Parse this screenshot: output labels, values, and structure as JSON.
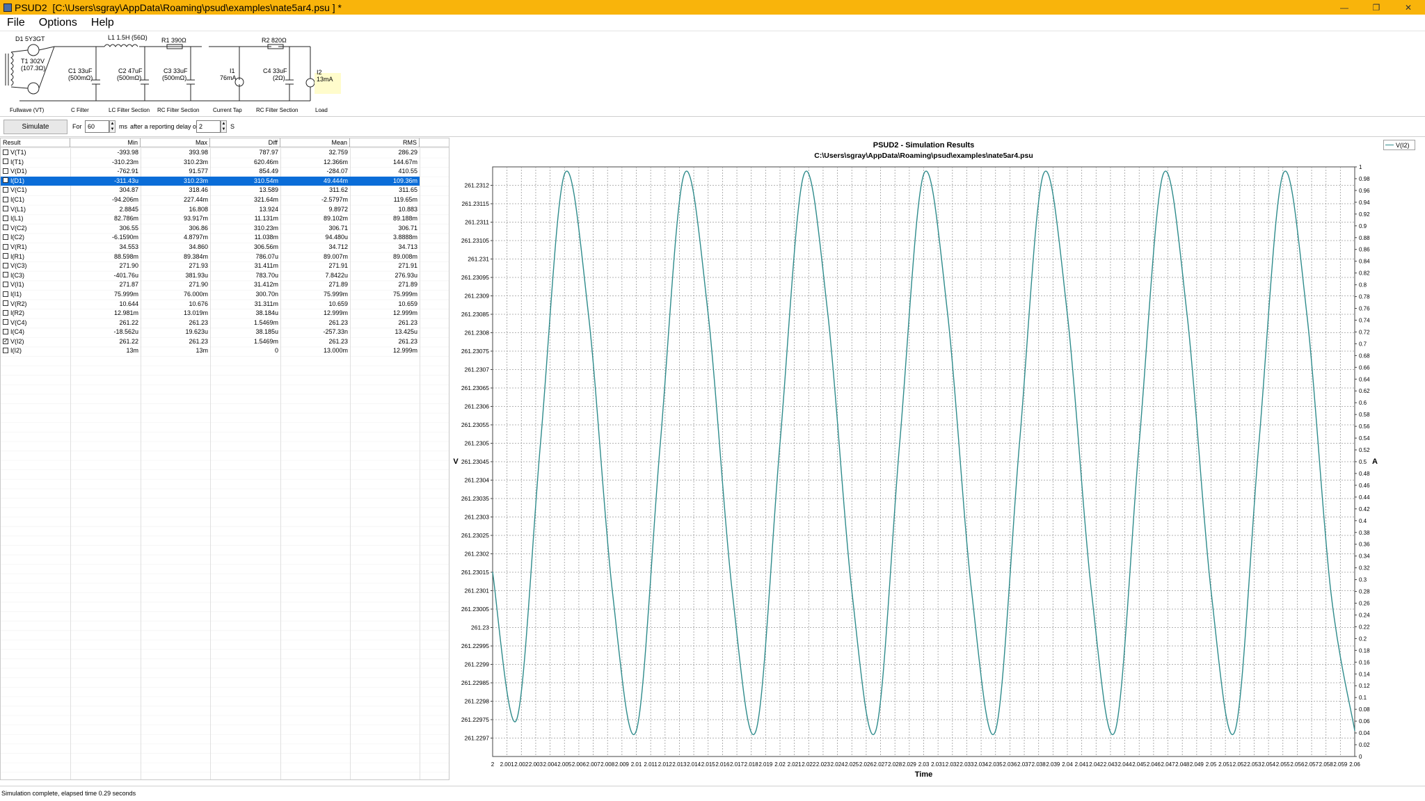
{
  "window": {
    "title": "PSUD2  [C:\\Users\\sgray\\AppData\\Roaming\\psud\\examples\\nate5ar4.psu ] *"
  },
  "menu": {
    "items": [
      "File",
      "Options",
      "Help"
    ]
  },
  "schematic": {
    "components": {
      "d1": "D1 5Y3GT",
      "t1_a": "T1 302V",
      "t1_b": "(107.3Ω)",
      "l1": "L1 1.5H (56Ω)",
      "r1": "R1 390Ω",
      "r2": "R2 820Ω",
      "c1_a": "C1 33uF",
      "c1_b": "(500mΩ)",
      "c2_a": "C2 47uF",
      "c2_b": "(500mΩ)",
      "c3_a": "C3 33uF",
      "c3_b": "(500mΩ)",
      "i1_a": "I1",
      "i1_b": "76mA",
      "c4_a": "C4 33uF",
      "c4_b": "(2Ω)",
      "i2_a": "I2",
      "i2_b": "13mA"
    },
    "section_labels": [
      "Fullwave (VT)",
      "C Filter",
      "LC Filter Section",
      "RC Filter Section",
      "Current Tap",
      "RC Filter Section",
      "Load"
    ]
  },
  "toolbar": {
    "simulate_label": "Simulate",
    "for_label": "For",
    "for_value": "60",
    "ms_label": "ms",
    "delay_label": "after a reporting delay of",
    "delay_value": "2",
    "s_label": "S"
  },
  "results": {
    "headers": [
      "Result",
      "Min",
      "Max",
      "Diff",
      "Mean",
      "RMS"
    ],
    "rows": [
      {
        "name": "V(T1)",
        "min": "-393.98",
        "max": "393.98",
        "diff": "787.97",
        "mean": "32.759",
        "rms": "286.29",
        "checked": false,
        "selected": false
      },
      {
        "name": "I(T1)",
        "min": "-310.23m",
        "max": "310.23m",
        "diff": "620.46m",
        "mean": "12.366m",
        "rms": "144.67m",
        "checked": false,
        "selected": false
      },
      {
        "name": "V(D1)",
        "min": "-762.91",
        "max": "91.577",
        "diff": "854.49",
        "mean": "-284.07",
        "rms": "410.55",
        "checked": false,
        "selected": false
      },
      {
        "name": "I(D1)",
        "min": "-311.43u",
        "max": "310.23m",
        "diff": "310.54m",
        "mean": "49.444m",
        "rms": "109.36m",
        "checked": false,
        "selected": true
      },
      {
        "name": "V(C1)",
        "min": "304.87",
        "max": "318.46",
        "diff": "13.589",
        "mean": "311.62",
        "rms": "311.65",
        "checked": false,
        "selected": false
      },
      {
        "name": "I(C1)",
        "min": "-94.206m",
        "max": "227.44m",
        "diff": "321.64m",
        "mean": "-2.5797m",
        "rms": "119.65m",
        "checked": false,
        "selected": false
      },
      {
        "name": "V(L1)",
        "min": "2.8845",
        "max": "16.808",
        "diff": "13.924",
        "mean": "9.8972",
        "rms": "10.883",
        "checked": false,
        "selected": false
      },
      {
        "name": "I(L1)",
        "min": "82.786m",
        "max": "93.917m",
        "diff": "11.131m",
        "mean": "89.102m",
        "rms": "89.188m",
        "checked": false,
        "selected": false
      },
      {
        "name": "V(C2)",
        "min": "306.55",
        "max": "306.86",
        "diff": "310.23m",
        "mean": "306.71",
        "rms": "306.71",
        "checked": false,
        "selected": false
      },
      {
        "name": "I(C2)",
        "min": "-6.1590m",
        "max": "4.8797m",
        "diff": "11.038m",
        "mean": "94.480u",
        "rms": "3.8888m",
        "checked": false,
        "selected": false
      },
      {
        "name": "V(R1)",
        "min": "34.553",
        "max": "34.860",
        "diff": "306.56m",
        "mean": "34.712",
        "rms": "34.713",
        "checked": false,
        "selected": false
      },
      {
        "name": "I(R1)",
        "min": "88.598m",
        "max": "89.384m",
        "diff": "786.07u",
        "mean": "89.007m",
        "rms": "89.008m",
        "checked": false,
        "selected": false
      },
      {
        "name": "V(C3)",
        "min": "271.90",
        "max": "271.93",
        "diff": "31.411m",
        "mean": "271.91",
        "rms": "271.91",
        "checked": false,
        "selected": false
      },
      {
        "name": "I(C3)",
        "min": "-401.76u",
        "max": "381.93u",
        "diff": "783.70u",
        "mean": "7.8422u",
        "rms": "276.93u",
        "checked": false,
        "selected": false
      },
      {
        "name": "V(I1)",
        "min": "271.87",
        "max": "271.90",
        "diff": "31.412m",
        "mean": "271.89",
        "rms": "271.89",
        "checked": false,
        "selected": false
      },
      {
        "name": "I(I1)",
        "min": "75.999m",
        "max": "76.000m",
        "diff": "300.70n",
        "mean": "75.999m",
        "rms": "75.999m",
        "checked": false,
        "selected": false
      },
      {
        "name": "V(R2)",
        "min": "10.644",
        "max": "10.676",
        "diff": "31.311m",
        "mean": "10.659",
        "rms": "10.659",
        "checked": false,
        "selected": false
      },
      {
        "name": "I(R2)",
        "min": "12.981m",
        "max": "13.019m",
        "diff": "38.184u",
        "mean": "12.999m",
        "rms": "12.999m",
        "checked": false,
        "selected": false
      },
      {
        "name": "V(C4)",
        "min": "261.22",
        "max": "261.23",
        "diff": "1.5469m",
        "mean": "261.23",
        "rms": "261.23",
        "checked": false,
        "selected": false
      },
      {
        "name": "I(C4)",
        "min": "-18.562u",
        "max": "19.623u",
        "diff": "38.185u",
        "mean": "-257.33n",
        "rms": "13.425u",
        "checked": false,
        "selected": false
      },
      {
        "name": "V(I2)",
        "min": "261.22",
        "max": "261.23",
        "diff": "1.5469m",
        "mean": "261.23",
        "rms": "261.23",
        "checked": true,
        "selected": false
      },
      {
        "name": "I(I2)",
        "min": "13m",
        "max": "13m",
        "diff": "0",
        "mean": "13.000m",
        "rms": "12.999m",
        "checked": false,
        "selected": false
      }
    ]
  },
  "chart_data": {
    "type": "line",
    "title": "PSUD2 - Simulation Results",
    "subtitle": "C:\\Users\\sgray\\AppData\\Roaming\\psud\\examples\\nate5ar4.psu",
    "xlabel": "Time",
    "ylabel": "V",
    "y2label": "A",
    "xlim": [
      2.0,
      2.06
    ],
    "ylim": [
      261.22965,
      261.23125
    ],
    "y2lim": [
      0,
      1
    ],
    "x_ticks": [
      "2",
      "2.001",
      "2.002",
      "2.003",
      "2.004",
      "2.005",
      "2.006",
      "2.007",
      "2.008",
      "2.009",
      "2.01",
      "2.011",
      "2.012",
      "2.013",
      "2.014",
      "2.015",
      "2.016",
      "2.017",
      "2.018",
      "2.019",
      "2.02",
      "2.021",
      "2.022",
      "2.023",
      "2.024",
      "2.025",
      "2.026",
      "2.027",
      "2.028",
      "2.029",
      "2.03",
      "2.031",
      "2.032",
      "2.033",
      "2.034",
      "2.035",
      "2.036",
      "2.037",
      "2.038",
      "2.039",
      "2.04",
      "2.041",
      "2.042",
      "2.043",
      "2.044",
      "2.045",
      "2.046",
      "2.047",
      "2.048",
      "2.049",
      "2.05",
      "2.051",
      "2.052",
      "2.053",
      "2.054",
      "2.055",
      "2.056",
      "2.057",
      "2.058",
      "2.059",
      "2.06"
    ],
    "y_ticks": [
      "261.2297",
      "261.22975",
      "261.2298",
      "261.22985",
      "261.2299",
      "261.22995",
      "261.23",
      "261.23005",
      "261.2301",
      "261.23015",
      "261.2302",
      "261.23025",
      "261.2303",
      "261.23035",
      "261.2304",
      "261.23045",
      "261.2305",
      "261.23055",
      "261.2306",
      "261.23065",
      "261.2307",
      "261.23075",
      "261.2308",
      "261.23085",
      "261.2309",
      "261.23095",
      "261.231",
      "261.23105",
      "261.2311",
      "261.23115",
      "261.2312"
    ],
    "y2_ticks": [
      "0",
      "0.02",
      "0.04",
      "0.06",
      "0.08",
      "0.1",
      "0.12",
      "0.14",
      "0.16",
      "0.18",
      "0.2",
      "0.22",
      "0.24",
      "0.26",
      "0.28",
      "0.3",
      "0.32",
      "0.34",
      "0.36",
      "0.38",
      "0.4",
      "0.42",
      "0.44",
      "0.46",
      "0.48",
      "0.5",
      "0.52",
      "0.54",
      "0.56",
      "0.58",
      "0.6",
      "0.62",
      "0.64",
      "0.66",
      "0.68",
      "0.7",
      "0.72",
      "0.74",
      "0.76",
      "0.78",
      "0.8",
      "0.82",
      "0.84",
      "0.86",
      "0.88",
      "0.9",
      "0.92",
      "0.94",
      "0.96",
      "0.98",
      "1"
    ],
    "grid": true,
    "legend": "top-right",
    "series": [
      {
        "name": "V(I2)",
        "color": "#2e8b8b",
        "x": [
          2.0,
          2.00167,
          2.00333,
          2.005,
          2.00667,
          2.00833,
          2.01,
          2.01167,
          2.01333,
          2.015,
          2.01667,
          2.01833,
          2.02,
          2.02167,
          2.02333,
          2.025,
          2.02667,
          2.02833,
          2.03,
          2.03167,
          2.03333,
          2.035,
          2.03667,
          2.03833,
          2.04,
          2.04167,
          2.04333,
          2.045,
          2.04667,
          2.04833,
          2.05,
          2.05167,
          2.05333,
          2.055,
          2.05667,
          2.05833,
          2.06
        ],
        "y": [
          261.23015,
          261.22975,
          261.2305,
          261.23123,
          261.23085,
          261.2301,
          261.22972,
          261.2305,
          261.23123,
          261.23085,
          261.2301,
          261.22972,
          261.2305,
          261.23123,
          261.23085,
          261.2301,
          261.22972,
          261.2305,
          261.23123,
          261.23085,
          261.2301,
          261.22972,
          261.2305,
          261.23123,
          261.23085,
          261.2301,
          261.22972,
          261.2305,
          261.23123,
          261.23085,
          261.2301,
          261.22972,
          261.2305,
          261.23123,
          261.23085,
          261.2301,
          261.22972
        ]
      }
    ]
  },
  "status": {
    "text": "Simulation complete, elapsed time 0.29 seconds"
  }
}
